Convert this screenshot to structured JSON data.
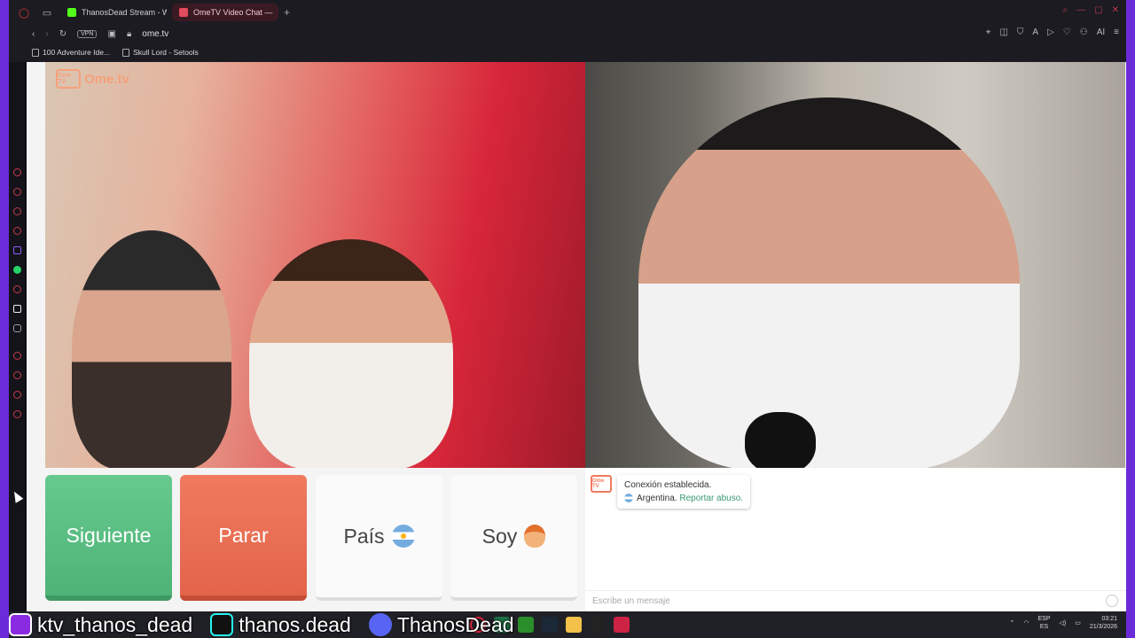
{
  "browser": {
    "tabs": [
      {
        "label": "ThanosDead Stream - Wa",
        "active": false,
        "favicon_color": "#53fc18"
      },
      {
        "label": "OmeTV Video Chat —",
        "active": true,
        "favicon_color": "#e34b5e"
      }
    ],
    "new_tab": "+",
    "vpn_badge": "VPN",
    "url": "ome.tv",
    "ai_label": "AI",
    "bookmarks": [
      {
        "label": "100 Adventure Ide..."
      },
      {
        "label": "Skull Lord - Setools"
      }
    ]
  },
  "ometv": {
    "logo_box": "Ome TV",
    "logo_text": "Ome.tv",
    "buttons": {
      "next": "Siguiente",
      "stop": "Parar",
      "country": "País",
      "me": "Soy"
    },
    "chat": {
      "logo": "Ome TV",
      "status": "Conexión establecida.",
      "country": "Argentina.",
      "report_link": "Reportar abuso.",
      "input_placeholder": "Escribe un mensaje"
    }
  },
  "stream_overlay": {
    "kick": "ktv_thanos_dead",
    "tiktok": "thanos.dead",
    "discord": "ThanosDead"
  },
  "taskbar": {
    "lang_top": "ESP",
    "lang_bottom": "ES",
    "time": "03:21",
    "date": "21/3/2026"
  },
  "colors": {
    "next_button": "#5bbf84",
    "stop_button": "#ea6e53",
    "accent": "#3a9a73",
    "frame_border": "#6c2bd9"
  }
}
